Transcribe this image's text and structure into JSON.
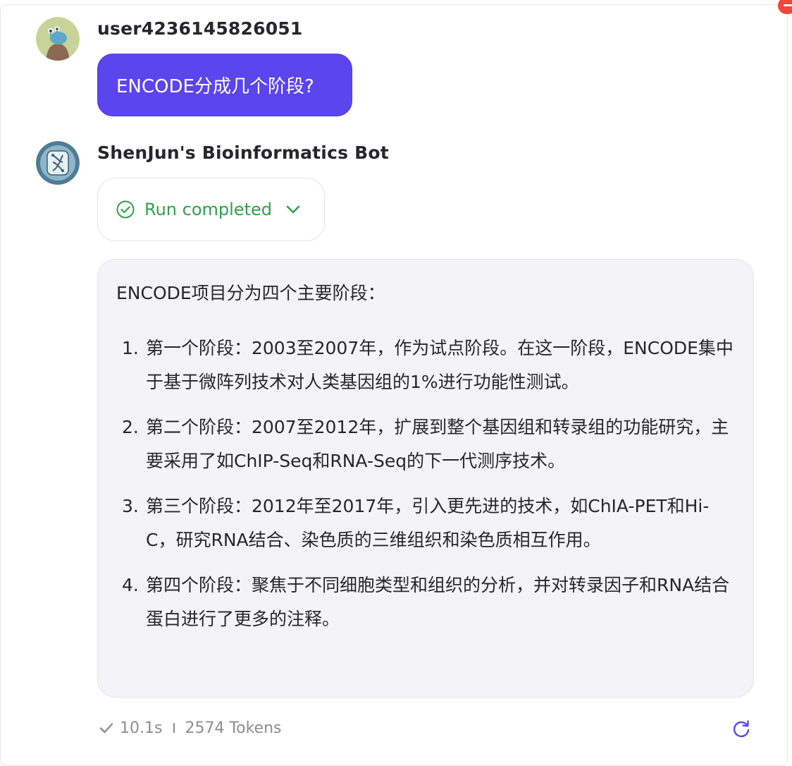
{
  "user_message": {
    "username": "user4236145826051",
    "text": "ENCODE分成几个阶段?"
  },
  "bot_message": {
    "bot_name": "ShenJun's Bioinformatics Bot",
    "run_status": "Run completed",
    "answer_intro": "ENCODE项目分为四个主要阶段：",
    "answer_items": [
      {
        "num": "1.",
        "text": "第一个阶段：2003至2007年，作为试点阶段。在这一阶段，ENCODE集中于基于微阵列技术对人类基因组的1%进行功能性测试。"
      },
      {
        "num": "2.",
        "text": "第二个阶段：2007至2012年，扩展到整个基因组和转录组的功能研究，主要采用了如ChIP-Seq和RNA-Seq的下一代测序技术。"
      },
      {
        "num": "3.",
        "text": "第三个阶段：2012年至2017年，引入更先进的技术，如ChIA-PET和Hi-C，研究RNA结合、染色质的三维组织和染色质相互作用。"
      },
      {
        "num": "4.",
        "text": "第四个阶段：聚焦于不同细胞类型和组织的分析，并对转录因子和RNA结合蛋白进行了更多的注释。"
      }
    ],
    "stats": {
      "duration": "10.1s",
      "tokens": "2574 Tokens"
    }
  },
  "icons": {
    "status_check": "check-circle-icon",
    "expand": "chevron-down-icon",
    "duration_check": "checkmark-icon",
    "regenerate": "refresh-icon",
    "close_badge": "minus-circle-icon"
  },
  "colors": {
    "user_bubble": "#5b45ef",
    "run_status_green": "#2fa04a",
    "answer_bg": "#f4f4f8",
    "accent_refresh": "#5b45ef",
    "badge_red": "#f0463c"
  }
}
